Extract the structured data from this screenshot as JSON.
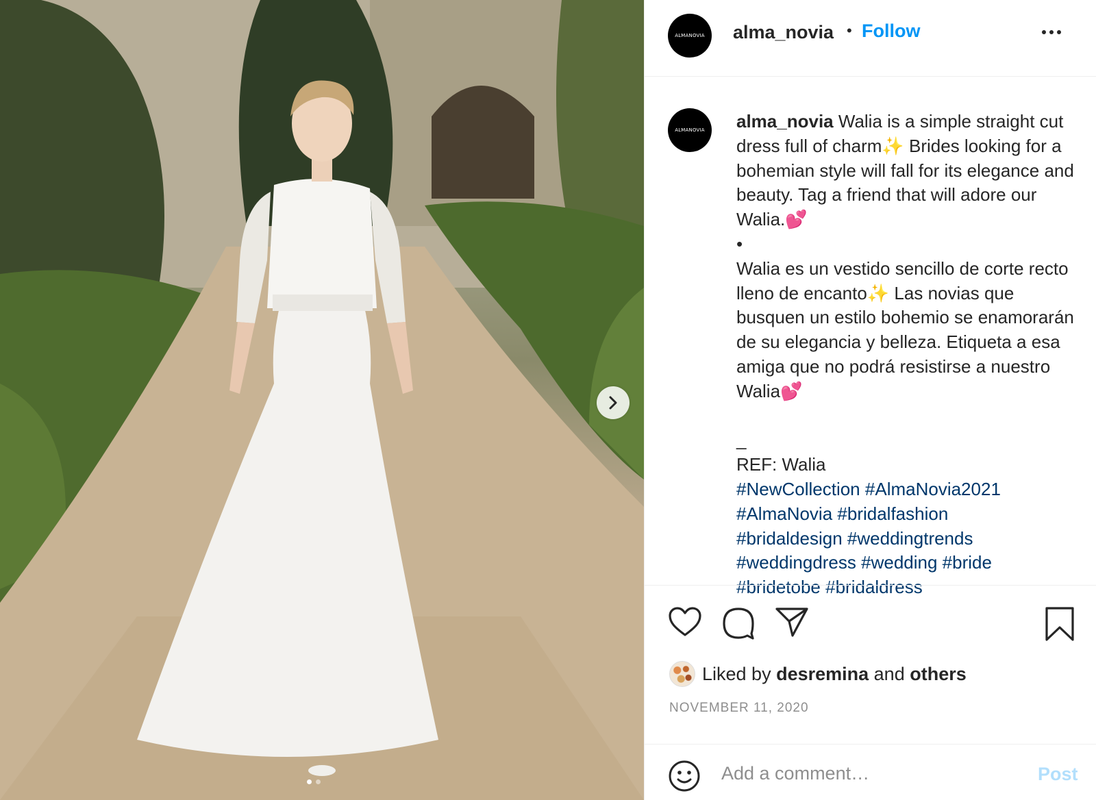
{
  "media": {
    "carousel_next_icon": "chevron-right-icon",
    "slide_count": 2,
    "active_slide": 1
  },
  "header": {
    "username": "alma_novia",
    "avatar_text": "ALMANOVIA",
    "separator": "•",
    "follow_label": "Follow",
    "more_icon": "more-horizontal-icon"
  },
  "caption": {
    "username": "alma_novia",
    "avatar_text": "ALMANOVIA",
    "text_en": " Walia is a simple straight cut dress full of charm✨ Brides looking for a bohemian style will fall for its elegance and beauty. Tag a friend that will adore our Walia.💕",
    "bullet": "•",
    "text_es": "Walia es un vestido sencillo de corte recto lleno de encanto✨ Las novias que busquen un estilo bohemio se enamorarán de su elegancia y belleza. Etiqueta a esa amiga que no podrá resistirse a nuestro Walia💕",
    "divider": "_",
    "ref": "REF: Walia",
    "hashtags": [
      "#NewCollection",
      "#AlmaNovia2021",
      "#AlmaNovia",
      "#bridalfashion",
      "#bridaldesign",
      "#weddingtrends",
      "#weddingdress",
      "#wedding",
      "#bride",
      "#bridetobe",
      "#bridaldress"
    ]
  },
  "actions": {
    "like_icon": "heart-icon",
    "comment_icon": "comment-icon",
    "share_icon": "share-icon",
    "save_icon": "bookmark-icon"
  },
  "likes": {
    "prefix": "Liked by ",
    "user": "desremina",
    "middle": " and ",
    "suffix": "others"
  },
  "date": "NOVEMBER 11, 2020",
  "comment": {
    "emoji_icon": "smiley-icon",
    "placeholder": "Add a comment…",
    "post_label": "Post",
    "post_color": "#b2dffc"
  },
  "colors": {
    "follow": "#0095f6",
    "hashtag": "#00376b",
    "text": "#262626",
    "muted": "#8e8e8e"
  }
}
